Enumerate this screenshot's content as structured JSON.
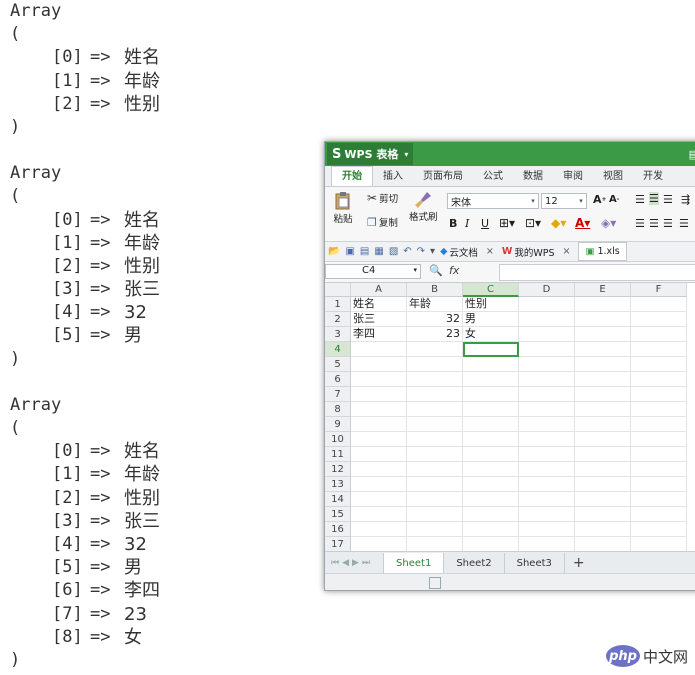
{
  "console": {
    "blocks": [
      {
        "kw": "Array",
        "open": "(",
        "close": ")",
        "entries": [
          {
            "i": "[0]",
            "v": "姓名"
          },
          {
            "i": "[1]",
            "v": "年龄"
          },
          {
            "i": "[2]",
            "v": "性别"
          }
        ]
      },
      {
        "kw": "Array",
        "open": "(",
        "close": ")",
        "entries": [
          {
            "i": "[0]",
            "v": "姓名"
          },
          {
            "i": "[1]",
            "v": "年龄"
          },
          {
            "i": "[2]",
            "v": "性别"
          },
          {
            "i": "[3]",
            "v": "张三"
          },
          {
            "i": "[4]",
            "v": "32"
          },
          {
            "i": "[5]",
            "v": "男"
          }
        ]
      },
      {
        "kw": "Array",
        "open": "(",
        "close": ")",
        "entries": [
          {
            "i": "[0]",
            "v": "姓名"
          },
          {
            "i": "[1]",
            "v": "年龄"
          },
          {
            "i": "[2]",
            "v": "性别"
          },
          {
            "i": "[3]",
            "v": "张三"
          },
          {
            "i": "[4]",
            "v": "32"
          },
          {
            "i": "[5]",
            "v": "男"
          },
          {
            "i": "[6]",
            "v": "李四"
          },
          {
            "i": "[7]",
            "v": "23"
          },
          {
            "i": "[8]",
            "v": "女"
          }
        ]
      }
    ],
    "arrow": "=>"
  },
  "wps": {
    "app_name": "WPS 表格",
    "app_logo": "S",
    "menu_tabs": [
      "开始",
      "插入",
      "页面布局",
      "公式",
      "数据",
      "审阅",
      "视图",
      "开发"
    ],
    "ribbon": {
      "paste": "粘贴",
      "cut": "剪切",
      "copy": "复制",
      "format_painter": "格式刷",
      "font_name": "宋体",
      "font_size": "12"
    },
    "quickbar": {
      "cloud_docs": "云文档",
      "my_wps": "我的WPS",
      "current_file": "1.xls"
    },
    "name_box": "C4",
    "fx_label": "fx",
    "columns": [
      "A",
      "B",
      "C",
      "D",
      "E",
      "F"
    ],
    "selected_column": "C",
    "rows": [
      "1",
      "2",
      "3",
      "4",
      "5",
      "6",
      "7",
      "8",
      "9",
      "10",
      "11",
      "12",
      "13",
      "14",
      "15",
      "16",
      "17"
    ],
    "selected_row": "4",
    "cells": {
      "A1": "姓名",
      "B1": "年龄",
      "C1": "性别",
      "A2": "张三",
      "B2": "32",
      "C2": "男",
      "A3": "李四",
      "B3": "23",
      "C3": "女"
    },
    "sheets": [
      "Sheet1",
      "Sheet2",
      "Sheet3"
    ],
    "active_sheet": "Sheet1",
    "accent_color": "#3a9a45"
  },
  "watermark": {
    "logo": "php",
    "text": "中文网"
  }
}
